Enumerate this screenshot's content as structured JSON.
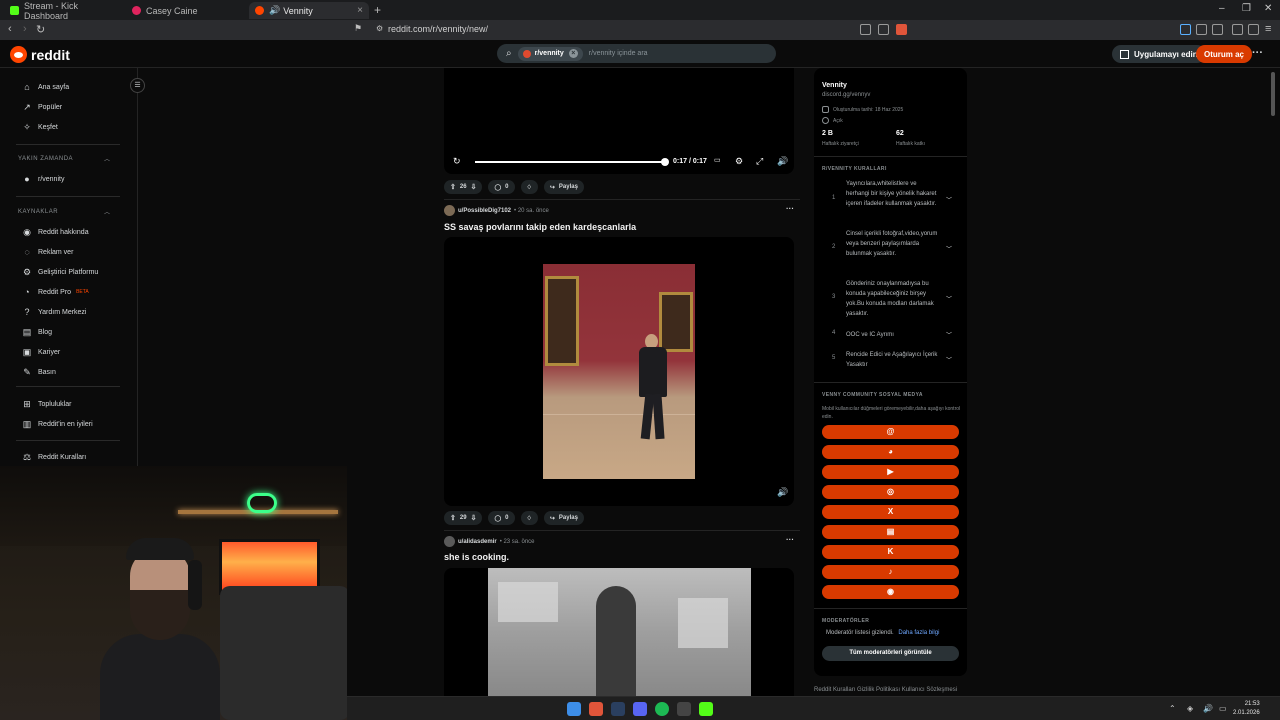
{
  "browser": {
    "tabs": [
      {
        "label": "Stream - Kick Dashboard",
        "color": "#53fc18"
      },
      {
        "label": "Casey Caine",
        "color": "#e0245e"
      },
      {
        "label": "Vennity",
        "color": "#ff4500",
        "active": true
      }
    ],
    "url": "reddit.com/r/vennity/new/"
  },
  "header": {
    "logo_text": "reddit",
    "search_chip": "r/vennity",
    "search_placeholder": "r/vennity içinde ara",
    "app_button": "Uygulamayı edin",
    "login_button": "Oturum aç"
  },
  "sidebar": {
    "main": [
      {
        "label": "Ana sayfa",
        "icon": "home-icon"
      },
      {
        "label": "Popüler",
        "icon": "popular-icon"
      },
      {
        "label": "Keşfet",
        "icon": "explore-icon"
      }
    ],
    "recent_heading": "YAKIN ZAMANDA",
    "recent": [
      {
        "label": "r/vennity"
      }
    ],
    "resources_heading": "KAYNAKLAR",
    "resources": [
      {
        "label": "Reddit hakkında"
      },
      {
        "label": "Reklam ver"
      },
      {
        "label": "Geliştirici Platformu"
      },
      {
        "label": "Reddit Pro",
        "badge": "BETA"
      },
      {
        "label": "Yardım Merkezi"
      },
      {
        "label": "Blog"
      },
      {
        "label": "Kariyer"
      },
      {
        "label": "Basın"
      }
    ],
    "communities": [
      {
        "label": "Topluluklar"
      },
      {
        "label": "Reddit'in en iyileri"
      }
    ],
    "rules": "Reddit Kuralları"
  },
  "feed": {
    "post0": {
      "time": "0:17 / 0:17",
      "upvotes": "26",
      "comments": "0",
      "share": "Paylaş"
    },
    "post1": {
      "user": "u/PossibleDig7102",
      "time": "20 sa. önce",
      "title": "SS savaş povlarını takip eden kardeşcanlarla",
      "upvotes": "29",
      "comments": "0",
      "share": "Paylaş"
    },
    "post2": {
      "user": "u/alidasdemir",
      "time": "23 sa. önce",
      "title": "she is cooking."
    }
  },
  "community": {
    "name": "Vennity",
    "link": "discord.gg/vennyv",
    "created": "Oluşturulma tarihi: 18 Haz 2025",
    "visibility": "Açık",
    "stat1_value": "2 B",
    "stat1_label": "Haftalık ziyaretçi",
    "stat2_value": "62",
    "stat2_label": "Haftalık katkı",
    "rules_heading": "R/VENNITY KURALLARI",
    "rules": [
      {
        "n": "1",
        "text": "Yayıncılara,whitelistlere ve herhangi bir kişiye yönelik hakaret içeren ifadeler kullanmak yasaktır."
      },
      {
        "n": "2",
        "text": "Cinsel içerikli fotoğraf,video,yorum veya benzeri paylaşımlarda bulunmak yasaktır."
      },
      {
        "n": "3",
        "text": "Gönderiniz onaylanmadıysa bu konuda yapabileceğiniz birşey yok.Bu konuda modları darlamak yasaktır."
      },
      {
        "n": "4",
        "text": "OOC ve IC Ayrımı"
      },
      {
        "n": "5",
        "text": "Rencide Edici ve Aşağılayıcı İçerik Yasaktır"
      }
    ],
    "social_heading": "VENNY COMMUNITY SOSYAL MEDYA",
    "social_note": "Mobil kullanıcılar düğmeleri göremeyebilir,daha aşağıyı kontrol edin.",
    "socials": [
      {
        "icon": "threads-icon",
        "glyph": "@"
      },
      {
        "icon": "discord-icon",
        "glyph": "◕"
      },
      {
        "icon": "youtube-icon",
        "glyph": "▶"
      },
      {
        "icon": "instagram-icon",
        "glyph": "◎"
      },
      {
        "icon": "x-icon",
        "glyph": "X"
      },
      {
        "icon": "twitch-icon",
        "glyph": "▤"
      },
      {
        "icon": "kick-icon",
        "glyph": "K"
      },
      {
        "icon": "tiktok-icon",
        "glyph": "♪"
      },
      {
        "icon": "steam-icon",
        "glyph": "◉"
      }
    ],
    "mods_heading": "MODERATÖRLER",
    "mods_hidden": "Moderatör listesi gizlendi.",
    "mods_more": "Daha fazla bilgi",
    "mods_button": "Tüm moderatörleri görüntüle"
  },
  "footer": "Reddit Kuralları  Gizlilik Politikası  Kullanıcı Sözleşmesi",
  "taskbar": {
    "time": "21:53",
    "date": "2.01.2026"
  },
  "colors": {
    "accent": "#ff4500",
    "button": "#d93a00",
    "background": "#0b0b0b"
  }
}
